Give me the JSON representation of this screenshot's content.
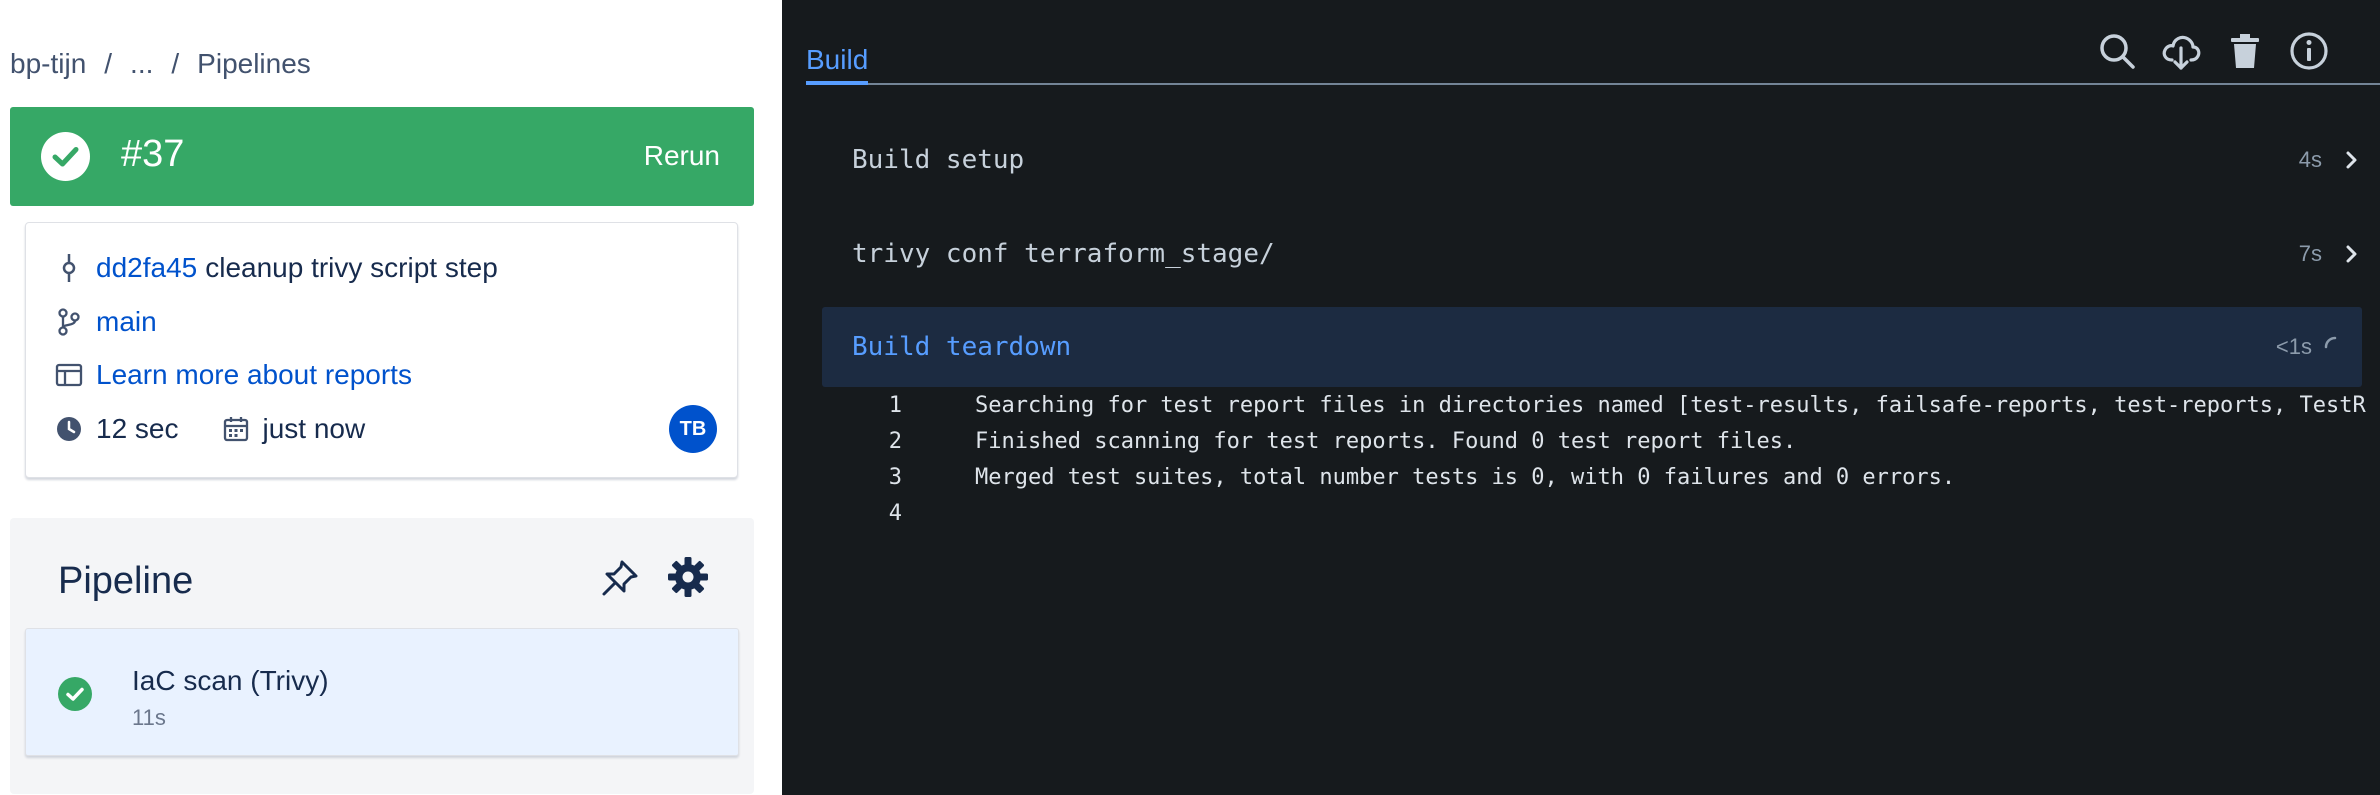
{
  "breadcrumb": {
    "items": [
      "bp-tijn",
      "...",
      "Pipelines"
    ],
    "separator": "/"
  },
  "run": {
    "number": "#37",
    "status": "successful",
    "rerun_label": "Rerun",
    "status_color": "#36a866"
  },
  "commit": {
    "hash": "dd2fa45",
    "message": "cleanup trivy script step"
  },
  "branch": {
    "name": "main"
  },
  "reports_link": "Learn more about reports",
  "meta": {
    "duration": "12 sec",
    "time_ago": "just now"
  },
  "user": {
    "initials": "TB"
  },
  "pipeline": {
    "title": "Pipeline",
    "steps": [
      {
        "name": "IaC scan (Trivy)",
        "duration": "11s",
        "status": "successful"
      }
    ]
  },
  "log_panel": {
    "tab_label": "Build",
    "toolbar_icons": [
      "search-icon",
      "download-cloud-icon",
      "trash-icon",
      "info-icon"
    ],
    "sections": [
      {
        "title": "Build setup",
        "duration": "4s",
        "state": "collapsed"
      },
      {
        "title": "trivy conf terraform_stage/",
        "duration": "7s",
        "state": "collapsed"
      },
      {
        "title": "Build teardown",
        "duration": "<1s",
        "state": "running"
      }
    ],
    "lines": [
      {
        "n": "1",
        "text": "Searching for test report files in directories named [test-results, failsafe-reports, test-reports, TestR"
      },
      {
        "n": "2",
        "text": "Finished scanning for test reports. Found 0 test report files."
      },
      {
        "n": "3",
        "text": "Merged test suites, total number tests is 0, with 0 failures and 0 errors."
      },
      {
        "n": "4",
        "text": ""
      }
    ]
  },
  "colors": {
    "accent_blue": "#0052cc",
    "log_accent": "#579dff",
    "success": "#36a866",
    "log_bg": "#161a1d"
  }
}
